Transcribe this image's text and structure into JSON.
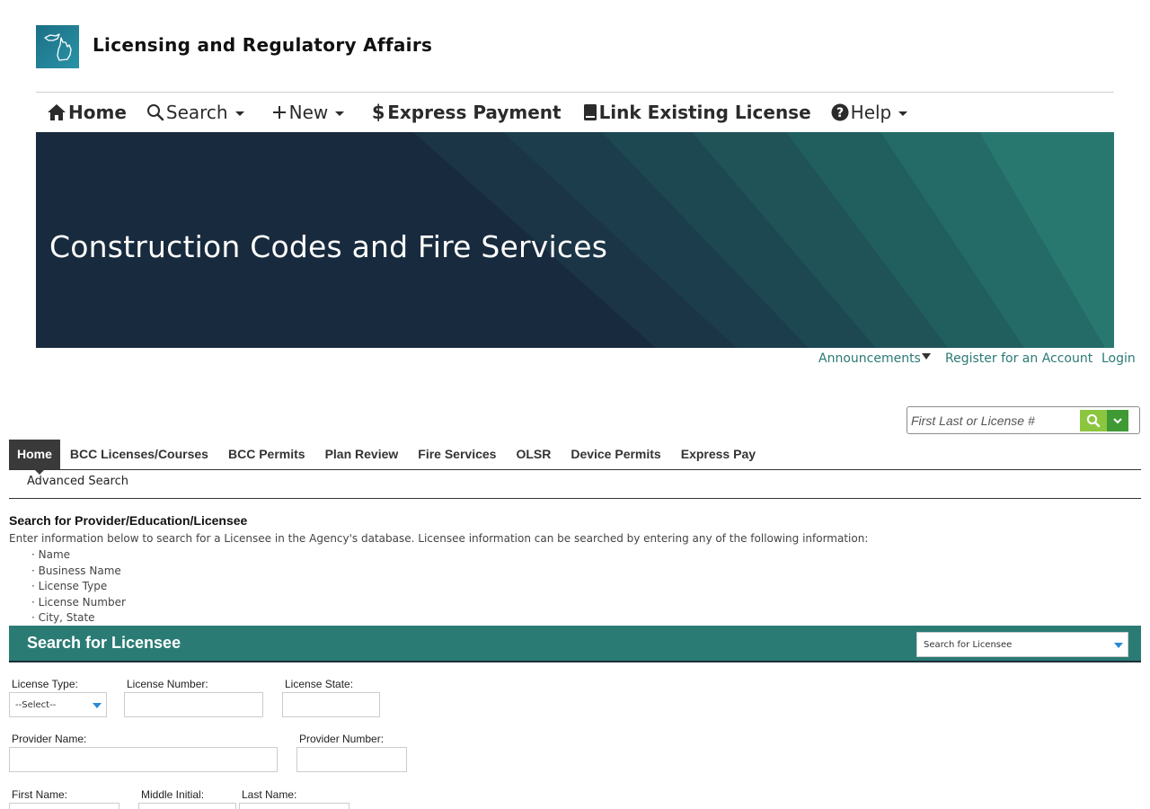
{
  "header": {
    "app_title": "Licensing and Regulatory Affairs"
  },
  "nav": {
    "home": "Home",
    "search": "Search",
    "new": "New",
    "express_payment": "Express Payment",
    "link_license": "Link Existing License",
    "help": "Help"
  },
  "banner": {
    "title": "Construction Codes and Fire Services"
  },
  "util_links": {
    "announcements": "Announcements",
    "register": "Register for an Account",
    "login": "Login"
  },
  "quick_search": {
    "placeholder": "First Last or License #"
  },
  "tabs": [
    {
      "label": "Home"
    },
    {
      "label": "BCC Licenses/Courses"
    },
    {
      "label": "BCC Permits"
    },
    {
      "label": "Plan Review"
    },
    {
      "label": "Fire Services"
    },
    {
      "label": "OLSR"
    },
    {
      "label": "Device Permits"
    },
    {
      "label": "Express Pay"
    }
  ],
  "subnav": {
    "advanced_search": "Advanced Search"
  },
  "intro": {
    "title": "Search for Provider/Education/Licensee",
    "text": "Enter information below to search for a Licensee in the Agency's database. Licensee information can be searched by entering any of the following information:",
    "bullets": [
      "· Name",
      "· Business Name",
      "· License Type",
      "· License Number",
      "· City, State"
    ]
  },
  "section": {
    "title": "Search for Licensee",
    "search_type": "Search for Licensee"
  },
  "form": {
    "license_type_label": "License Type:",
    "license_type_value": "--Select--",
    "license_number_label": "License Number:",
    "license_state_label": "License State:",
    "provider_name_label": "Provider Name:",
    "provider_number_label": "Provider Number:",
    "first_name_label": "First Name:",
    "middle_initial_label": "Middle Initial:",
    "last_name_label": "Last Name:"
  },
  "colors": {
    "teal": "#2b7b75",
    "navy": "#182a3d",
    "link": "#2a7a75",
    "green": "#8cc63f",
    "dark_green": "#3f9a34"
  }
}
